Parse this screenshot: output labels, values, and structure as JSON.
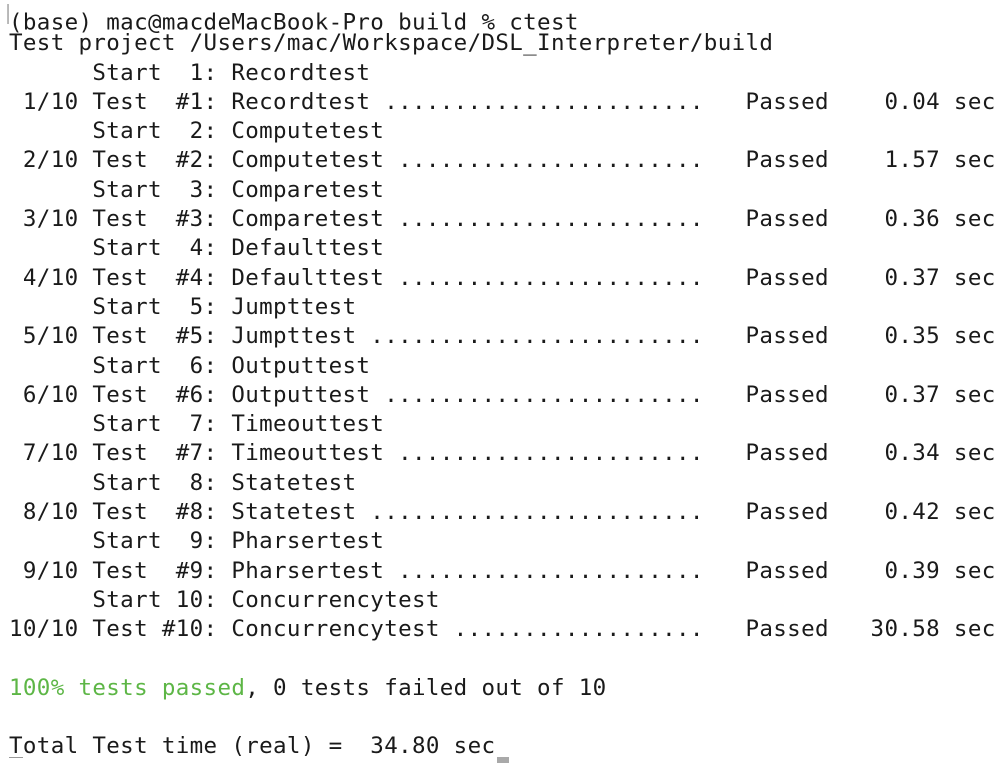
{
  "terminal": {
    "prompt": "(base) mac@macdeMacBook-Pro build % ctest",
    "project_line": "Test project /Users/mac/Workspace/DSL_Interpreter/build",
    "tests": [
      {
        "start": "      Start  1: Recordtest",
        "result": " 1/10 Test  #1: Recordtest .......................   Passed    0.04 sec"
      },
      {
        "start": "      Start  2: Computetest",
        "result": " 2/10 Test  #2: Computetest ......................   Passed    1.57 sec"
      },
      {
        "start": "      Start  3: Comparetest",
        "result": " 3/10 Test  #3: Comparetest ......................   Passed    0.36 sec"
      },
      {
        "start": "      Start  4: Defaulttest",
        "result": " 4/10 Test  #4: Defaulttest ......................   Passed    0.37 sec"
      },
      {
        "start": "      Start  5: Jumpttest",
        "result": " 5/10 Test  #5: Jumpttest ........................   Passed    0.35 sec"
      },
      {
        "start": "      Start  6: Outputtest",
        "result": " 6/10 Test  #6: Outputtest .......................   Passed    0.37 sec"
      },
      {
        "start": "      Start  7: Timeouttest",
        "result": " 7/10 Test  #7: Timeouttest ......................   Passed    0.34 sec"
      },
      {
        "start": "      Start  8: Statetest",
        "result": " 8/10 Test  #8: Statetest ........................   Passed    0.42 sec"
      },
      {
        "start": "      Start  9: Pharsertest",
        "result": " 9/10 Test  #9: Pharsertest ......................   Passed    0.39 sec"
      },
      {
        "start": "      Start 10: Concurrencytest",
        "result": "10/10 Test #10: Concurrencytest ..................   Passed   30.58 sec"
      }
    ],
    "summary_pass": "100% tests passed",
    "summary_rest": ", 0 tests failed out of 10",
    "total_time": "Total Test time (real) =  34.80 sec",
    "colors": {
      "text": "#1a1a1a",
      "pass_green": "#5db646",
      "background": "#ffffff"
    }
  }
}
